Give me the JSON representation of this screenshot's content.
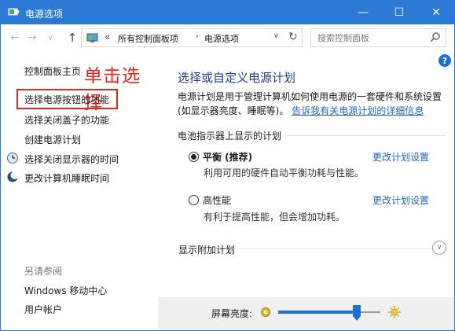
{
  "window": {
    "title": "电源选项",
    "controls": {
      "minimize": "—",
      "maximize": "☐",
      "close": "✕"
    }
  },
  "address": {
    "chevron": "«",
    "crumbs": [
      "所有控制面板项",
      "电源选项"
    ],
    "separator": "›",
    "dropdown": "∨",
    "refresh": "↻"
  },
  "search": {
    "placeholder": "搜索控制面板"
  },
  "nav_glyphs": {
    "back": "←",
    "forward": "→",
    "recent": "∨",
    "up": "↑"
  },
  "help": "?",
  "left_nav": {
    "home": "控制面板主页",
    "annotation": "单击选择",
    "links": [
      "选择电源按钮的功能",
      "选择关闭盖子的功能",
      "创建电源计划",
      "选择关闭显示器的时间",
      "更改计算机睡眠时间"
    ],
    "see_also_title": "另请参阅",
    "see_also": [
      "Windows 移动中心",
      "用户帐户"
    ]
  },
  "main": {
    "title": "选择或自定义电源计划",
    "description": "电源计划是用于管理计算机如何使用电源的一套硬件和系统设置(如显示器亮度、睡眠等)。",
    "description_link": "告诉我有关电源计划的详细信息",
    "section_title": "电池指示器上显示的计划",
    "plans": [
      {
        "name": "平衡 (推荐)",
        "desc": "利用可用的硬件自动平衡功耗与性能。",
        "link": "更改计划设置",
        "selected": true
      },
      {
        "name": "高性能",
        "desc": "有利于提高性能，但会增加功耗。",
        "link": "更改计划设置",
        "selected": false
      }
    ],
    "show_more": "显示附加计划",
    "expand_glyph": "∨"
  },
  "brightness": {
    "label": "屏幕亮度:",
    "level": 0.77
  },
  "colors": {
    "titlebar": "#2b7bd6",
    "link": "#1f66c2",
    "annotation_red": "#e8241f",
    "heading": "#1e3f8c"
  }
}
